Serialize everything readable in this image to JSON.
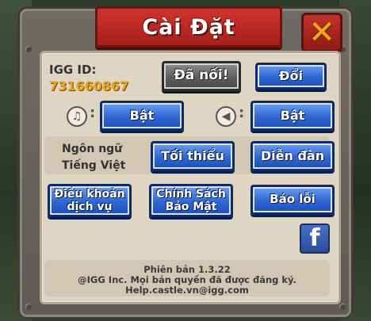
{
  "title": "Cài Đặt",
  "close_label": "✕",
  "account": {
    "id_label": "IGG ID:",
    "id_value": "731660867",
    "connected_label": "Đã nối!",
    "change_label": "Đổi"
  },
  "music": {
    "icon": "music-note-icon",
    "colon": ":",
    "toggle_label": "Bật"
  },
  "sound": {
    "icon": "speaker-icon",
    "colon": ":",
    "toggle_label": "Bật"
  },
  "language": {
    "label": "Ngôn ngữ",
    "value": "Tiếng Việt",
    "minimize_label": "Tối thiểu",
    "forum_label": "Diễn đàn"
  },
  "links": {
    "terms_line1": "Điều khoản",
    "terms_line2": "dịch vụ",
    "privacy_line1": "Chính Sách",
    "privacy_line2": "Bảo Mật",
    "report_label": "Báo lỗi"
  },
  "facebook_label": "f",
  "footer": {
    "version": "Phiên bản 1.3.22",
    "copyright": "@IGG Inc. Mọi bản quyền đã được đăng ký.",
    "email": "Help.castle.vn@igg.com"
  },
  "colors": {
    "accent_blue": "#2f66d3",
    "title_red": "#c5322a",
    "id_gold": "#e9a520"
  }
}
